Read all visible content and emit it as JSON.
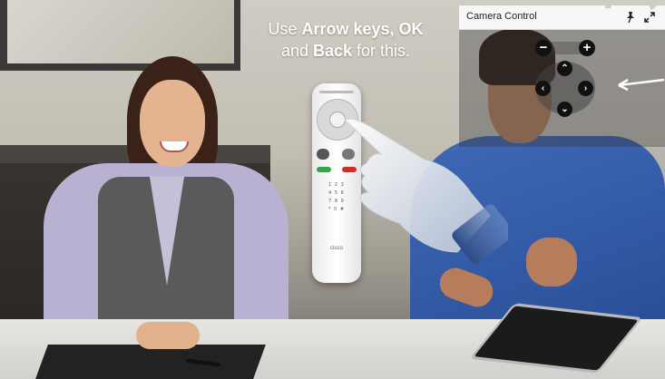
{
  "instruction": {
    "line1_prefix": "Use ",
    "line1_bold": "Arrow keys, OK",
    "line2_prefix": "and ",
    "line2_bold": "Back",
    "line2_suffix": " for this."
  },
  "camera_control": {
    "title": "Camera Control",
    "zoom_out_symbol": "−",
    "zoom_in_symbol": "+",
    "up_symbol": "⌃",
    "down_symbol": "⌄",
    "left_symbol": "‹",
    "right_symbol": "›"
  },
  "remote": {
    "keypad": "1 2 3\n4 5 6\n7 8 9\n* 0 #",
    "logo": "cisco"
  },
  "icons": {
    "pin": "pin-icon",
    "expand": "expand-icon"
  },
  "colors": {
    "green_call": "#2ea84a",
    "red_end": "#d62b2b",
    "overlay_button": "#111111"
  }
}
